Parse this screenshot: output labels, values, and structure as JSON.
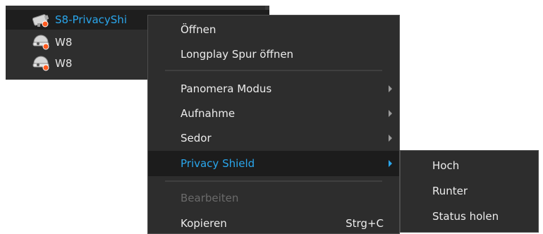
{
  "device_list": {
    "items": [
      {
        "label": "S8-PrivacyShi",
        "icon": "camera-icon",
        "selected": true
      },
      {
        "label": "W8",
        "icon": "camera-icon",
        "selected": false
      },
      {
        "label": "W8",
        "icon": "camera-icon",
        "selected": false
      }
    ]
  },
  "context_menu": {
    "open": "Öffnen",
    "longplay_open": "Longplay Spur öffnen",
    "panomera_mode": "Panomera Modus",
    "recording": "Aufnahme",
    "sedor": "Sedor",
    "privacy_shield": "Privacy Shield",
    "edit": "Bearbeiten",
    "copy": "Kopieren",
    "copy_shortcut": "Strg+C"
  },
  "privacy_submenu": {
    "up": "Hoch",
    "down": "Runter",
    "get_status": "Status holen"
  },
  "colors": {
    "menu_bg": "#2d2d2d",
    "highlight_text": "#2aa6ec",
    "disabled_text": "#6a6a6a",
    "status_dot": "#ff5a1f"
  }
}
